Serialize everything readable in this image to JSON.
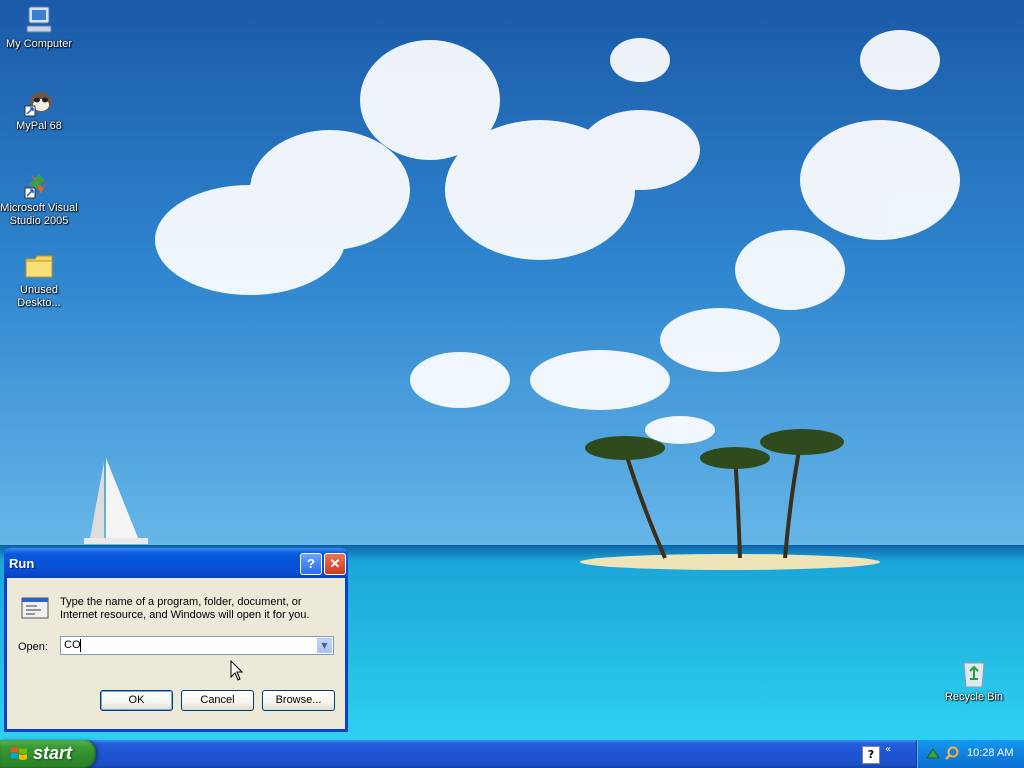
{
  "desktop": {
    "icons": [
      {
        "label": "My Computer"
      },
      {
        "label": "MyPal 68"
      },
      {
        "label": "Microsoft Visual Studio 2005"
      },
      {
        "label": "Unused Deskto..."
      },
      {
        "label": "Recycle Bin"
      }
    ]
  },
  "run_dialog": {
    "title": "Run",
    "help_glyph": "?",
    "close_glyph": "✕",
    "instruction": "Type the name of a program, folder, document, or Internet resource, and Windows will open it for you.",
    "open_label": "Open:",
    "open_value": "CO",
    "ok_label": "OK",
    "cancel_label": "Cancel",
    "browse_label": "Browse..."
  },
  "taskbar": {
    "start_label": "start",
    "clock": "10:28 AM"
  },
  "colors": {
    "taskbar_blue": "#245edb",
    "start_green": "#3e9c3a",
    "dialog_face": "#ece9d8"
  }
}
